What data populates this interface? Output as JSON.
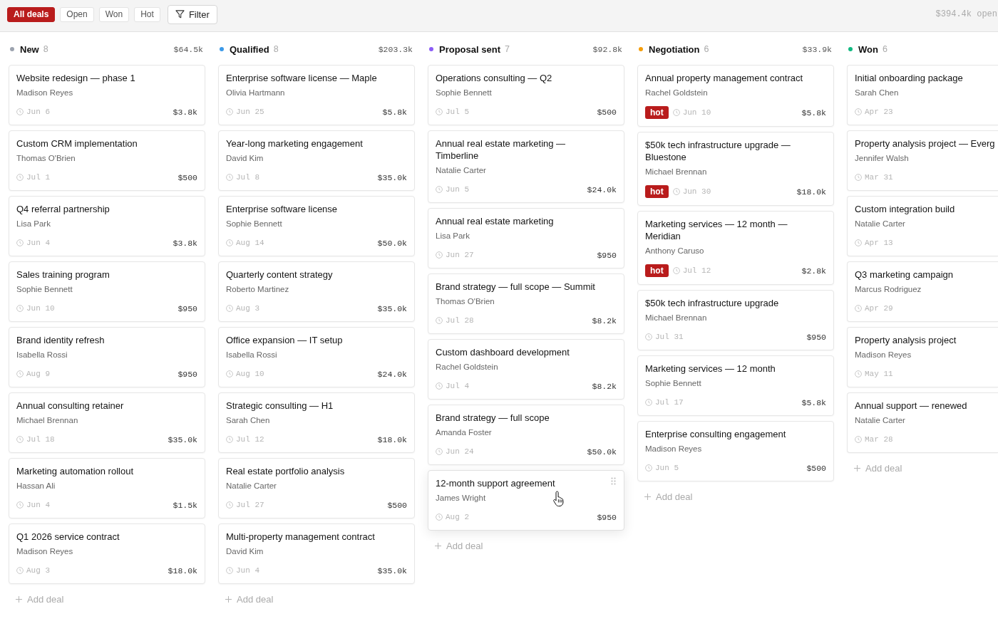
{
  "filters": [
    {
      "label": "All deals",
      "selected": true
    },
    {
      "label": "Open",
      "selected": false
    },
    {
      "label": "Won",
      "selected": false
    },
    {
      "label": "Hot",
      "selected": false
    }
  ],
  "filter_button": {
    "label": "Filter"
  },
  "summary": "$394.4k open",
  "columns": [
    {
      "name": "New",
      "count": "8",
      "total": "$64.5k",
      "color": "#9ca3af",
      "add_label": "Add deal",
      "cards": [
        {
          "title": "Website redesign — phase 1",
          "contact": "Madison Reyes",
          "date": "Jun 6",
          "amount": "$3.8k",
          "hovered": false
        },
        {
          "title": "Custom CRM implementation",
          "contact": "Thomas O'Brien",
          "date": "Jul 1",
          "amount": "$500",
          "hovered": false
        },
        {
          "title": "Q4 referral partnership",
          "contact": "Lisa Park",
          "date": "Jun 4",
          "amount": "$3.8k",
          "hovered": false
        },
        {
          "title": "Sales training program",
          "contact": "Sophie Bennett",
          "date": "Jun 10",
          "amount": "$950",
          "hovered": false
        },
        {
          "title": "Brand identity refresh",
          "contact": "Isabella Rossi",
          "date": "Aug 9",
          "amount": "$950",
          "hovered": false
        },
        {
          "title": "Annual consulting retainer",
          "contact": "Michael Brennan",
          "date": "Jul 18",
          "amount": "$35.0k",
          "hovered": false
        },
        {
          "title": "Marketing automation rollout",
          "contact": "Hassan Ali",
          "date": "Jun 4",
          "amount": "$1.5k",
          "hovered": false
        },
        {
          "title": "Q1 2026 service contract",
          "contact": "Madison Reyes",
          "date": "Aug 3",
          "amount": "$18.0k",
          "hovered": false
        }
      ]
    },
    {
      "name": "Qualified",
      "count": "8",
      "total": "$203.3k",
      "color": "#3b99e8",
      "add_label": "Add deal",
      "cards": [
        {
          "title": "Enterprise software license — Maple",
          "contact": "Olivia Hartmann",
          "date": "Jun 25",
          "amount": "$5.8k",
          "hovered": false
        },
        {
          "title": "Year-long marketing engagement",
          "contact": "David Kim",
          "date": "Jul 8",
          "amount": "$35.0k",
          "hovered": false
        },
        {
          "title": "Enterprise software license",
          "contact": "Sophie Bennett",
          "date": "Aug 14",
          "amount": "$50.0k",
          "hovered": false
        },
        {
          "title": "Quarterly content strategy",
          "contact": "Roberto Martinez",
          "date": "Aug 3",
          "amount": "$35.0k",
          "hovered": false
        },
        {
          "title": "Office expansion — IT setup",
          "contact": "Isabella Rossi",
          "date": "Aug 10",
          "amount": "$24.0k",
          "hovered": false
        },
        {
          "title": "Strategic consulting — H1",
          "contact": "Sarah Chen",
          "date": "Jul 12",
          "amount": "$18.0k",
          "hovered": false
        },
        {
          "title": "Real estate portfolio analysis",
          "contact": "Natalie Carter",
          "date": "Jul 27",
          "amount": "$500",
          "hovered": false
        },
        {
          "title": "Multi-property management contract",
          "contact": "David Kim",
          "date": "Jun 4",
          "amount": "$35.0k",
          "hovered": false
        }
      ]
    },
    {
      "name": "Proposal sent",
      "count": "7",
      "total": "$92.8k",
      "color": "#8b5cf6",
      "add_label": "Add deal",
      "cards": [
        {
          "title": "Operations consulting — Q2",
          "contact": "Sophie Bennett",
          "date": "Jul 5",
          "amount": "$500",
          "hovered": false
        },
        {
          "title": "Annual real estate marketing — Timberline",
          "contact": "Natalie Carter",
          "date": "Jun 5",
          "amount": "$24.0k",
          "hovered": false
        },
        {
          "title": "Annual real estate marketing",
          "contact": "Lisa Park",
          "date": "Jun 27",
          "amount": "$950",
          "hovered": false
        },
        {
          "title": "Brand strategy — full scope — Summit",
          "contact": "Thomas O'Brien",
          "date": "Jul 28",
          "amount": "$8.2k",
          "hovered": false
        },
        {
          "title": "Custom dashboard development",
          "contact": "Rachel Goldstein",
          "date": "Jul 4",
          "amount": "$8.2k",
          "hovered": false
        },
        {
          "title": "Brand strategy — full scope",
          "contact": "Amanda Foster",
          "date": "Jun 24",
          "amount": "$50.0k",
          "hovered": false
        },
        {
          "title": "12-month support agreement",
          "contact": "James Wright",
          "date": "Aug 2",
          "amount": "$950",
          "hovered": true
        }
      ]
    },
    {
      "name": "Negotiation",
      "count": "6",
      "total": "$33.9k",
      "color": "#f59e0b",
      "add_label": "Add deal",
      "cards": [
        {
          "title": "Annual property management contract",
          "contact": "Rachel Goldstein",
          "tag": "hot",
          "date": "Jun 10",
          "amount": "$5.8k",
          "hovered": false
        },
        {
          "title": "$50k tech infrastructure upgrade — Bluestone",
          "contact": "Michael Brennan",
          "tag": "hot",
          "date": "Jun 30",
          "amount": "$18.0k",
          "hovered": false
        },
        {
          "title": "Marketing services — 12 month — Meridian",
          "contact": "Anthony Caruso",
          "tag": "hot",
          "date": "Jul 12",
          "amount": "$2.8k",
          "hovered": false
        },
        {
          "title": "$50k tech infrastructure upgrade",
          "contact": "Michael Brennan",
          "date": "Jul 31",
          "amount": "$950",
          "hovered": false
        },
        {
          "title": "Marketing services — 12 month",
          "contact": "Sophie Bennett",
          "date": "Jul 17",
          "amount": "$5.8k",
          "hovered": false
        },
        {
          "title": "Enterprise consulting engagement",
          "contact": "Madison Reyes",
          "date": "Jun 5",
          "amount": "$500",
          "hovered": false
        }
      ]
    },
    {
      "name": "Won",
      "count": "6",
      "color": "#10b981",
      "add_label": "Add deal",
      "cards": [
        {
          "title": "Initial onboarding package",
          "contact": "Sarah Chen",
          "date": "Apr 23",
          "hovered": false
        },
        {
          "title": "Property analysis project — Everg",
          "contact": "Jennifer Walsh",
          "date": "Mar 31",
          "hovered": false
        },
        {
          "title": "Custom integration build",
          "contact": "Natalie Carter",
          "date": "Apr 13",
          "hovered": false
        },
        {
          "title": "Q3 marketing campaign",
          "contact": "Marcus Rodriguez",
          "date": "Apr 29",
          "hovered": false
        },
        {
          "title": "Property analysis project",
          "contact": "Madison Reyes",
          "date": "May 11",
          "hovered": false
        },
        {
          "title": "Annual support — renewed",
          "contact": "Natalie Carter",
          "date": "Mar 28",
          "hovered": false
        }
      ]
    }
  ]
}
